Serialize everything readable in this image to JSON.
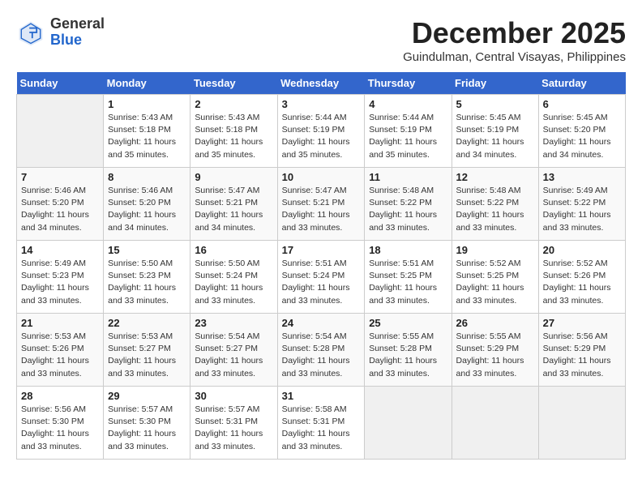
{
  "header": {
    "logo_general": "General",
    "logo_blue": "Blue",
    "month": "December 2025",
    "location": "Guindulman, Central Visayas, Philippines"
  },
  "days_of_week": [
    "Sunday",
    "Monday",
    "Tuesday",
    "Wednesday",
    "Thursday",
    "Friday",
    "Saturday"
  ],
  "weeks": [
    [
      {
        "day": "",
        "info": ""
      },
      {
        "day": "1",
        "info": "Sunrise: 5:43 AM\nSunset: 5:18 PM\nDaylight: 11 hours\nand 35 minutes."
      },
      {
        "day": "2",
        "info": "Sunrise: 5:43 AM\nSunset: 5:18 PM\nDaylight: 11 hours\nand 35 minutes."
      },
      {
        "day": "3",
        "info": "Sunrise: 5:44 AM\nSunset: 5:19 PM\nDaylight: 11 hours\nand 35 minutes."
      },
      {
        "day": "4",
        "info": "Sunrise: 5:44 AM\nSunset: 5:19 PM\nDaylight: 11 hours\nand 35 minutes."
      },
      {
        "day": "5",
        "info": "Sunrise: 5:45 AM\nSunset: 5:19 PM\nDaylight: 11 hours\nand 34 minutes."
      },
      {
        "day": "6",
        "info": "Sunrise: 5:45 AM\nSunset: 5:20 PM\nDaylight: 11 hours\nand 34 minutes."
      }
    ],
    [
      {
        "day": "7",
        "info": "Sunrise: 5:46 AM\nSunset: 5:20 PM\nDaylight: 11 hours\nand 34 minutes."
      },
      {
        "day": "8",
        "info": "Sunrise: 5:46 AM\nSunset: 5:20 PM\nDaylight: 11 hours\nand 34 minutes."
      },
      {
        "day": "9",
        "info": "Sunrise: 5:47 AM\nSunset: 5:21 PM\nDaylight: 11 hours\nand 34 minutes."
      },
      {
        "day": "10",
        "info": "Sunrise: 5:47 AM\nSunset: 5:21 PM\nDaylight: 11 hours\nand 33 minutes."
      },
      {
        "day": "11",
        "info": "Sunrise: 5:48 AM\nSunset: 5:22 PM\nDaylight: 11 hours\nand 33 minutes."
      },
      {
        "day": "12",
        "info": "Sunrise: 5:48 AM\nSunset: 5:22 PM\nDaylight: 11 hours\nand 33 minutes."
      },
      {
        "day": "13",
        "info": "Sunrise: 5:49 AM\nSunset: 5:22 PM\nDaylight: 11 hours\nand 33 minutes."
      }
    ],
    [
      {
        "day": "14",
        "info": "Sunrise: 5:49 AM\nSunset: 5:23 PM\nDaylight: 11 hours\nand 33 minutes."
      },
      {
        "day": "15",
        "info": "Sunrise: 5:50 AM\nSunset: 5:23 PM\nDaylight: 11 hours\nand 33 minutes."
      },
      {
        "day": "16",
        "info": "Sunrise: 5:50 AM\nSunset: 5:24 PM\nDaylight: 11 hours\nand 33 minutes."
      },
      {
        "day": "17",
        "info": "Sunrise: 5:51 AM\nSunset: 5:24 PM\nDaylight: 11 hours\nand 33 minutes."
      },
      {
        "day": "18",
        "info": "Sunrise: 5:51 AM\nSunset: 5:25 PM\nDaylight: 11 hours\nand 33 minutes."
      },
      {
        "day": "19",
        "info": "Sunrise: 5:52 AM\nSunset: 5:25 PM\nDaylight: 11 hours\nand 33 minutes."
      },
      {
        "day": "20",
        "info": "Sunrise: 5:52 AM\nSunset: 5:26 PM\nDaylight: 11 hours\nand 33 minutes."
      }
    ],
    [
      {
        "day": "21",
        "info": "Sunrise: 5:53 AM\nSunset: 5:26 PM\nDaylight: 11 hours\nand 33 minutes."
      },
      {
        "day": "22",
        "info": "Sunrise: 5:53 AM\nSunset: 5:27 PM\nDaylight: 11 hours\nand 33 minutes."
      },
      {
        "day": "23",
        "info": "Sunrise: 5:54 AM\nSunset: 5:27 PM\nDaylight: 11 hours\nand 33 minutes."
      },
      {
        "day": "24",
        "info": "Sunrise: 5:54 AM\nSunset: 5:28 PM\nDaylight: 11 hours\nand 33 minutes."
      },
      {
        "day": "25",
        "info": "Sunrise: 5:55 AM\nSunset: 5:28 PM\nDaylight: 11 hours\nand 33 minutes."
      },
      {
        "day": "26",
        "info": "Sunrise: 5:55 AM\nSunset: 5:29 PM\nDaylight: 11 hours\nand 33 minutes."
      },
      {
        "day": "27",
        "info": "Sunrise: 5:56 AM\nSunset: 5:29 PM\nDaylight: 11 hours\nand 33 minutes."
      }
    ],
    [
      {
        "day": "28",
        "info": "Sunrise: 5:56 AM\nSunset: 5:30 PM\nDaylight: 11 hours\nand 33 minutes."
      },
      {
        "day": "29",
        "info": "Sunrise: 5:57 AM\nSunset: 5:30 PM\nDaylight: 11 hours\nand 33 minutes."
      },
      {
        "day": "30",
        "info": "Sunrise: 5:57 AM\nSunset: 5:31 PM\nDaylight: 11 hours\nand 33 minutes."
      },
      {
        "day": "31",
        "info": "Sunrise: 5:58 AM\nSunset: 5:31 PM\nDaylight: 11 hours\nand 33 minutes."
      },
      {
        "day": "",
        "info": ""
      },
      {
        "day": "",
        "info": ""
      },
      {
        "day": "",
        "info": ""
      }
    ]
  ]
}
